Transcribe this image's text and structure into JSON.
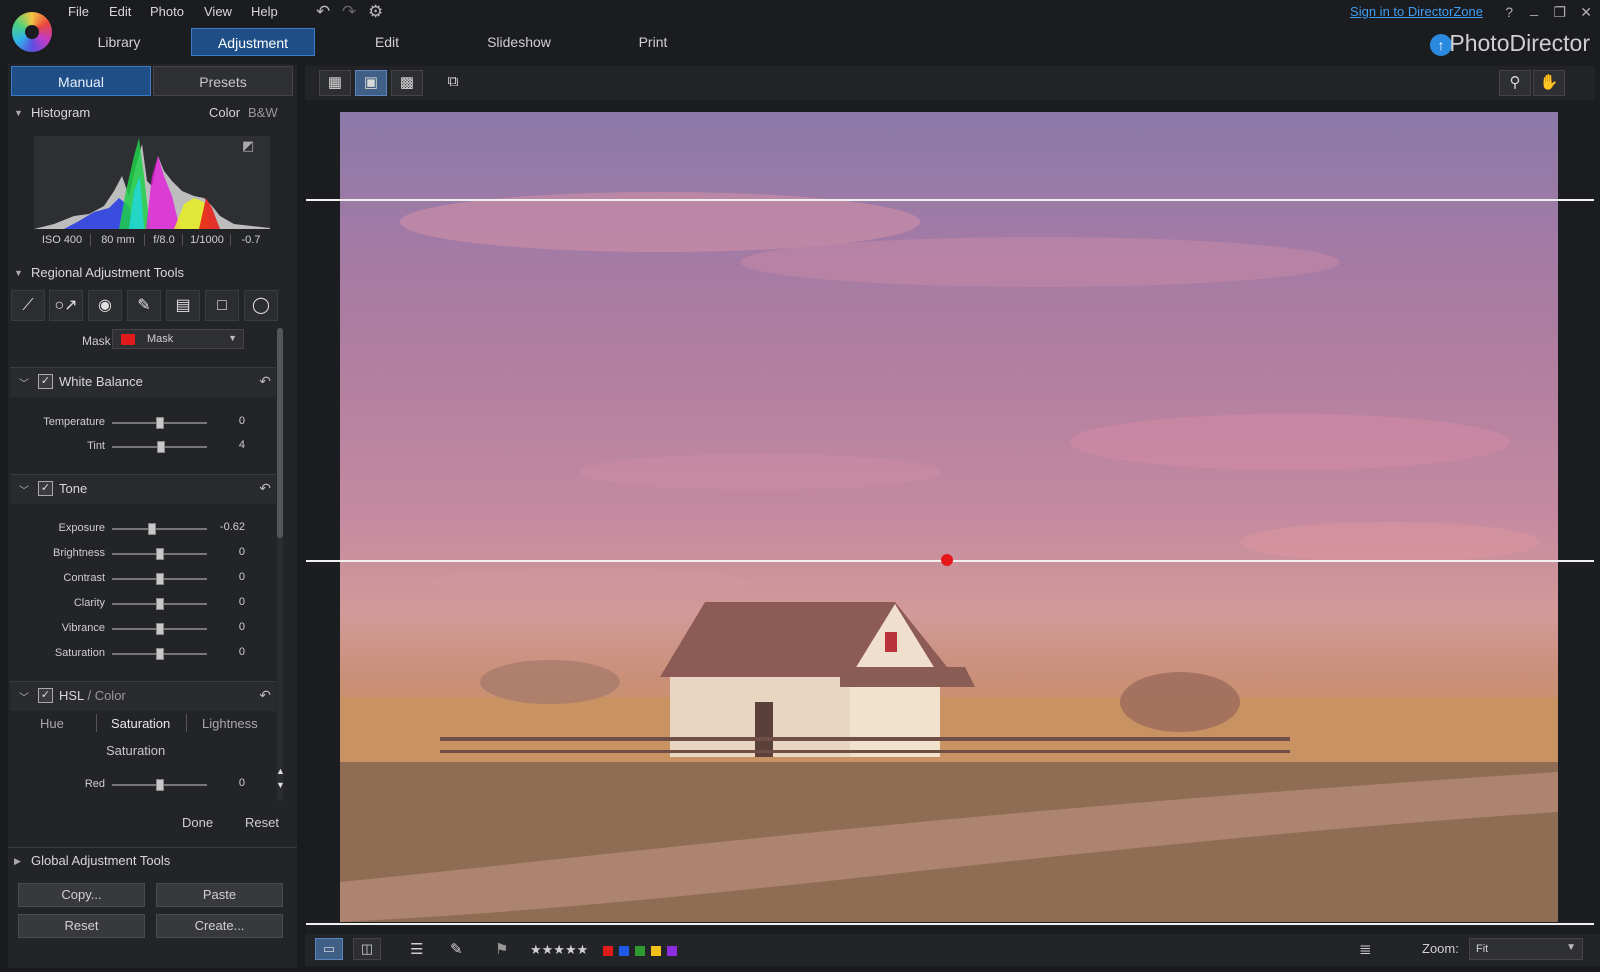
{
  "menu": [
    "File",
    "Edit",
    "Photo",
    "View",
    "Help"
  ],
  "signin_link": "Sign in to DirectorZone",
  "window_controls": {
    "help": "?",
    "minimize": "_",
    "restore": "❐",
    "close": "✕"
  },
  "main_tabs": [
    "Library",
    "Adjustment",
    "Edit",
    "Slideshow",
    "Print"
  ],
  "active_main_tab": "Adjustment",
  "brand": "PhotoDirector",
  "left_panel": {
    "tabs": [
      "Manual",
      "Presets"
    ],
    "histogram": {
      "title": "Histogram",
      "modes": [
        "Color",
        "B&W"
      ],
      "exif": [
        "ISO 400",
        "80 mm",
        "f/8.0",
        "1/1000",
        "-0.7"
      ]
    },
    "regional": {
      "title": "Regional Adjustment Tools",
      "tool_icons": [
        "crop-icon",
        "spot-removal-icon",
        "red-eye-icon",
        "brush-icon",
        "gradient-mask-icon",
        "rectangle-mask-icon",
        "radial-mask-icon"
      ],
      "mask_label": "Mask",
      "mask_value": "Mask",
      "mask_color": "#e01b1b"
    },
    "white_balance": {
      "title": "White Balance",
      "sliders": [
        {
          "label": "Temperature",
          "value": "0",
          "pos": 0.5
        },
        {
          "label": "Tint",
          "value": "4",
          "pos": 0.52
        }
      ]
    },
    "tone": {
      "title": "Tone",
      "sliders": [
        {
          "label": "Exposure",
          "value": "-0.62",
          "pos": 0.42
        },
        {
          "label": "Brightness",
          "value": "0",
          "pos": 0.5
        },
        {
          "label": "Contrast",
          "value": "0",
          "pos": 0.5
        },
        {
          "label": "Clarity",
          "value": "0",
          "pos": 0.5
        },
        {
          "label": "Vibrance",
          "value": "0",
          "pos": 0.5
        },
        {
          "label": "Saturation",
          "value": "0",
          "pos": 0.5
        }
      ]
    },
    "hsl": {
      "title": "HSL",
      "sep": "/",
      "subtitle": "Color",
      "tabs": [
        "Hue",
        "Saturation",
        "Lightness"
      ],
      "active_tab": "Saturation",
      "section_label": "Saturation",
      "sliders": [
        {
          "label": "Red",
          "value": "0",
          "pos": 0.5
        }
      ]
    },
    "done_label": "Done",
    "reset_label": "Reset",
    "global": {
      "title": "Global Adjustment Tools"
    },
    "buttons": {
      "copy": "Copy...",
      "paste": "Paste",
      "reset": "Reset",
      "create": "Create..."
    }
  },
  "view_toolbar": [
    "thumbnail-view-icon",
    "single-view-icon",
    "grid-view-icon",
    "compare-view-icon"
  ],
  "right_tools": [
    "zoom-tool-icon",
    "hand-tool-icon"
  ],
  "status_bar": {
    "rating_stars": "★★★★★",
    "color_labels": [
      "#e11b1b",
      "#1e5ae6",
      "#2f9a2f",
      "#f2c21a",
      "#8b2be2"
    ],
    "zoom_label": "Zoom:",
    "zoom_value": "Fit"
  }
}
